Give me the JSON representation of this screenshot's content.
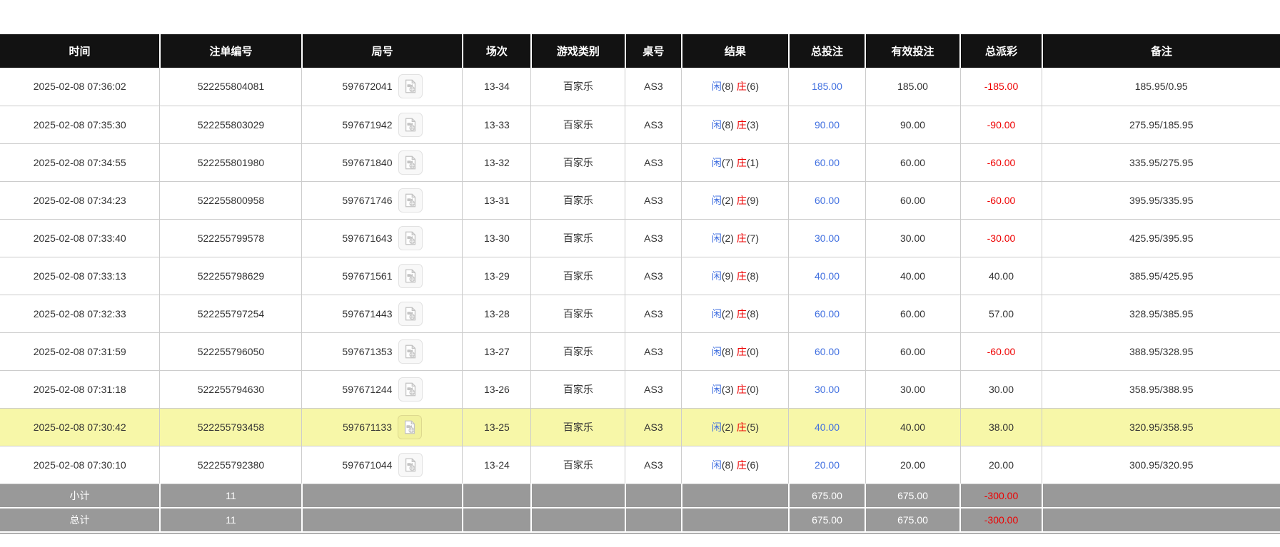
{
  "table": {
    "headers": [
      "时间",
      "注单编号",
      "局号",
      "场次",
      "游戏类别",
      "桌号",
      "结果",
      "总投注",
      "有效投注",
      "总派彩",
      "备注"
    ],
    "result_labels": {
      "player": "闲",
      "banker": "庄"
    },
    "icon": {
      "round_replay": "video-replay-icon"
    },
    "colors": {
      "header_bg": "#121212",
      "row_text": "#333333",
      "border": "#cccccc",
      "accent_blue": "#4170e0",
      "negative_red": "#ee0000",
      "highlight_yellow": "#f7f7a8",
      "summary_bg": "#999999"
    },
    "rows": [
      {
        "time": "2025-02-08 07:36:02",
        "bet_no": "522255804081",
        "round_no": "597672041",
        "session": "13-34",
        "game": "百家乐",
        "table_no": "AS3",
        "result": {
          "player": 8,
          "banker": 6
        },
        "total_bet": "185.00",
        "valid_bet": "185.00",
        "payout": "-185.00",
        "remark": "185.95/0.95",
        "highlighted": false
      },
      {
        "time": "2025-02-08 07:35:30",
        "bet_no": "522255803029",
        "round_no": "597671942",
        "session": "13-33",
        "game": "百家乐",
        "table_no": "AS3",
        "result": {
          "player": 8,
          "banker": 3
        },
        "total_bet": "90.00",
        "valid_bet": "90.00",
        "payout": "-90.00",
        "remark": "275.95/185.95",
        "highlighted": false
      },
      {
        "time": "2025-02-08 07:34:55",
        "bet_no": "522255801980",
        "round_no": "597671840",
        "session": "13-32",
        "game": "百家乐",
        "table_no": "AS3",
        "result": {
          "player": 7,
          "banker": 1
        },
        "total_bet": "60.00",
        "valid_bet": "60.00",
        "payout": "-60.00",
        "remark": "335.95/275.95",
        "highlighted": false
      },
      {
        "time": "2025-02-08 07:34:23",
        "bet_no": "522255800958",
        "round_no": "597671746",
        "session": "13-31",
        "game": "百家乐",
        "table_no": "AS3",
        "result": {
          "player": 2,
          "banker": 9
        },
        "total_bet": "60.00",
        "valid_bet": "60.00",
        "payout": "-60.00",
        "remark": "395.95/335.95",
        "highlighted": false
      },
      {
        "time": "2025-02-08 07:33:40",
        "bet_no": "522255799578",
        "round_no": "597671643",
        "session": "13-30",
        "game": "百家乐",
        "table_no": "AS3",
        "result": {
          "player": 2,
          "banker": 7
        },
        "total_bet": "30.00",
        "valid_bet": "30.00",
        "payout": "-30.00",
        "remark": "425.95/395.95",
        "highlighted": false
      },
      {
        "time": "2025-02-08 07:33:13",
        "bet_no": "522255798629",
        "round_no": "597671561",
        "session": "13-29",
        "game": "百家乐",
        "table_no": "AS3",
        "result": {
          "player": 9,
          "banker": 8
        },
        "total_bet": "40.00",
        "valid_bet": "40.00",
        "payout": "40.00",
        "remark": "385.95/425.95",
        "highlighted": false
      },
      {
        "time": "2025-02-08 07:32:33",
        "bet_no": "522255797254",
        "round_no": "597671443",
        "session": "13-28",
        "game": "百家乐",
        "table_no": "AS3",
        "result": {
          "player": 2,
          "banker": 8
        },
        "total_bet": "60.00",
        "valid_bet": "60.00",
        "payout": "57.00",
        "remark": "328.95/385.95",
        "highlighted": false
      },
      {
        "time": "2025-02-08 07:31:59",
        "bet_no": "522255796050",
        "round_no": "597671353",
        "session": "13-27",
        "game": "百家乐",
        "table_no": "AS3",
        "result": {
          "player": 8,
          "banker": 0
        },
        "total_bet": "60.00",
        "valid_bet": "60.00",
        "payout": "-60.00",
        "remark": "388.95/328.95",
        "highlighted": false
      },
      {
        "time": "2025-02-08 07:31:18",
        "bet_no": "522255794630",
        "round_no": "597671244",
        "session": "13-26",
        "game": "百家乐",
        "table_no": "AS3",
        "result": {
          "player": 3,
          "banker": 0
        },
        "total_bet": "30.00",
        "valid_bet": "30.00",
        "payout": "30.00",
        "remark": "358.95/388.95",
        "highlighted": false
      },
      {
        "time": "2025-02-08 07:30:42",
        "bet_no": "522255793458",
        "round_no": "597671133",
        "session": "13-25",
        "game": "百家乐",
        "table_no": "AS3",
        "result": {
          "player": 2,
          "banker": 5
        },
        "total_bet": "40.00",
        "valid_bet": "40.00",
        "payout": "38.00",
        "remark": "320.95/358.95",
        "highlighted": true
      },
      {
        "time": "2025-02-08 07:30:10",
        "bet_no": "522255792380",
        "round_no": "597671044",
        "session": "13-24",
        "game": "百家乐",
        "table_no": "AS3",
        "result": {
          "player": 8,
          "banker": 6
        },
        "total_bet": "20.00",
        "valid_bet": "20.00",
        "payout": "20.00",
        "remark": "300.95/320.95",
        "highlighted": false
      }
    ],
    "summary_rows": [
      {
        "label": "小计",
        "count": "11",
        "total_bet": "675.00",
        "valid_bet": "675.00",
        "payout": "-300.00"
      },
      {
        "label": "总计",
        "count": "11",
        "total_bet": "675.00",
        "valid_bet": "675.00",
        "payout": "-300.00"
      }
    ]
  }
}
